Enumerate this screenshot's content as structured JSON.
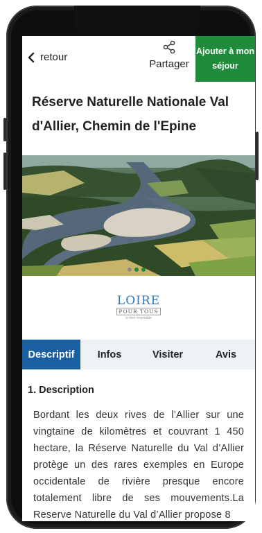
{
  "header": {
    "back_label": "retour",
    "share_label": "Partager",
    "add_button_label": "Ajouter à mon séjour"
  },
  "title": "Réserve Naturelle Nationale Val d'Allier, Chemin de l'Epine",
  "carousel": {
    "dots": [
      {
        "color": "#8a8a8a"
      },
      {
        "color": "#1e8c3a"
      },
      {
        "color": "#1e8c3a"
      }
    ]
  },
  "logo": {
    "word": "LOIRE",
    "sub": "POUR TOUS",
    "tagline": "à vivre ensemble"
  },
  "tabs": [
    {
      "label": "Descriptif",
      "active": true
    },
    {
      "label": "Infos",
      "active": false
    },
    {
      "label": "Visiter",
      "active": false
    },
    {
      "label": "Avis",
      "active": false
    }
  ],
  "section": {
    "title": "1. Description",
    "text": "Bordant les deux rives de l’Allier sur une vingtaine de kilomètres et couvrant 1 450 hectare, la Réserve Naturelle du Val d’Allier protège un des rares exemples en Europe occidentale de rivière presque encore totalement libre de ses mouvements.La Reserve Naturelle du Val d’Allier propose 8"
  },
  "colors": {
    "accent_green": "#1e8c3a",
    "tab_active": "#1a5fa0",
    "tab_bar": "#eef2f4"
  }
}
